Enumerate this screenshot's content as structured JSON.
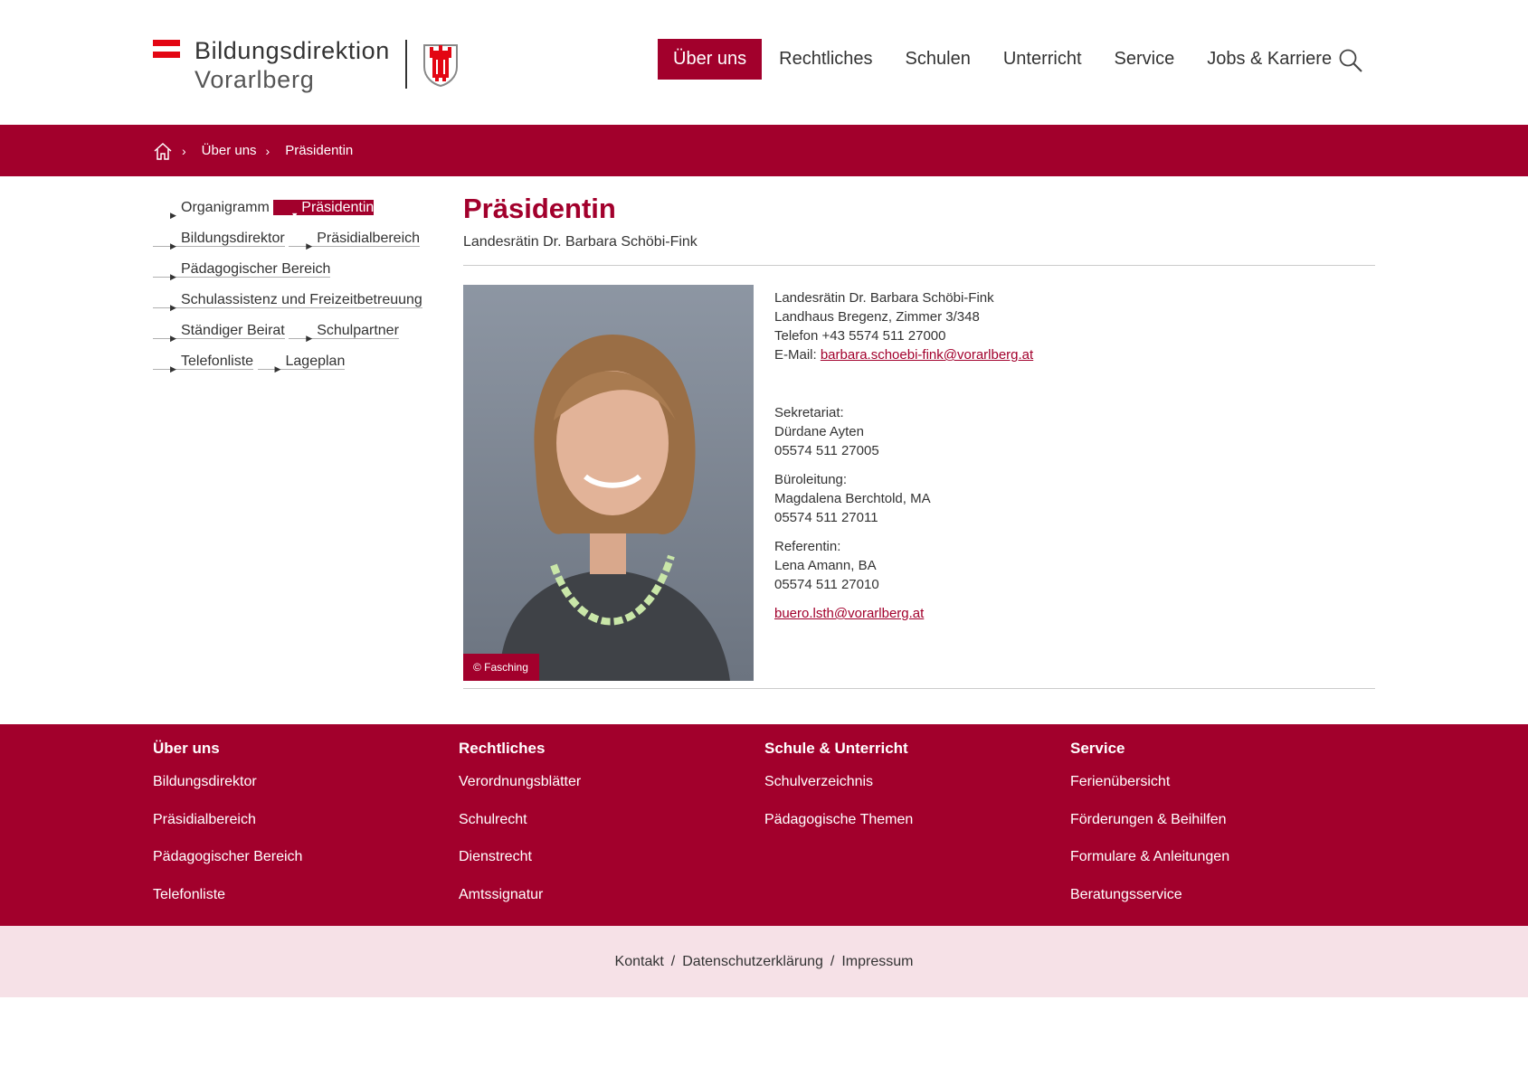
{
  "logo": {
    "line1": "Bildungsdirektion",
    "line2": "Vorarlberg"
  },
  "nav": {
    "items": [
      {
        "label": "Über uns",
        "active": true
      },
      {
        "label": "Rechtliches",
        "active": false
      },
      {
        "label": "Schulen",
        "active": false
      },
      {
        "label": "Unterricht",
        "active": false
      },
      {
        "label": "Service",
        "active": false
      },
      {
        "label": "Jobs & Karriere",
        "active": false
      }
    ],
    "search_icon": "search-icon"
  },
  "breadcrumb": {
    "items": [
      "Über uns",
      "Präsidentin"
    ]
  },
  "sidenav": {
    "items": [
      "Organigramm",
      "Präsidentin",
      "Bildungsdirektor",
      "Präsidialbereich",
      "Pädagogischer Bereich",
      "Schulassistenz und Freizeitbetreuung",
      "Ständiger Beirat",
      "Schulpartner",
      "Telefonliste",
      "Lageplan"
    ],
    "active_index": 1
  },
  "main": {
    "title": "Präsidentin",
    "subtitle": "Landesrätin Dr. Barbara Schöbi-Fink",
    "photo_credit": "© Fasching",
    "contact": {
      "name": "Landesrätin Dr. Barbara Schöbi-Fink",
      "address": "Landhaus Bregenz, Zimmer 3/348",
      "phone": "Telefon +43 5574 511 27000",
      "email_label": "E-Mail:",
      "email": "barbara.schoebi-fink@vorarlberg.at"
    },
    "sekretariat": {
      "label": "Sekretariat:",
      "name": "Dürdane Ayten",
      "phone": "05574 511 27005"
    },
    "bueroleitung": {
      "label": "Büroleitung:",
      "name": "Magdalena Berchtold, MA",
      "phone": "05574 511 27011"
    },
    "referentin": {
      "label": "Referentin:",
      "name": "Lena Amann, BA",
      "phone": "05574 511 27010"
    },
    "office_email": "buero.lsth@vorarlberg.at"
  },
  "footer": {
    "columns": [
      {
        "title": "Über uns",
        "links": [
          "Bildungsdirektor",
          "Präsidialbereich",
          "Pädagogischer Bereich",
          "Telefonliste"
        ]
      },
      {
        "title": "Rechtliches",
        "links": [
          "Verordnungsblätter",
          "Schulrecht",
          "Dienstrecht",
          "Amtssignatur"
        ]
      },
      {
        "title": "Schule & Unterricht",
        "links": [
          "Schulverzeichnis",
          "Pädagogische Themen"
        ]
      },
      {
        "title": "Service",
        "links": [
          "Ferienübersicht",
          "Förderungen & Beihilfen",
          "Formulare & Anleitungen",
          "Beratungsservice"
        ]
      }
    ],
    "bottom_links": [
      "Kontakt",
      "Datenschutzerklärung",
      "Impressum"
    ],
    "separator": "/"
  },
  "colors": {
    "brand": "#a2002c",
    "footer_bottom_bg": "#f6e1e7",
    "text": "#333333"
  }
}
